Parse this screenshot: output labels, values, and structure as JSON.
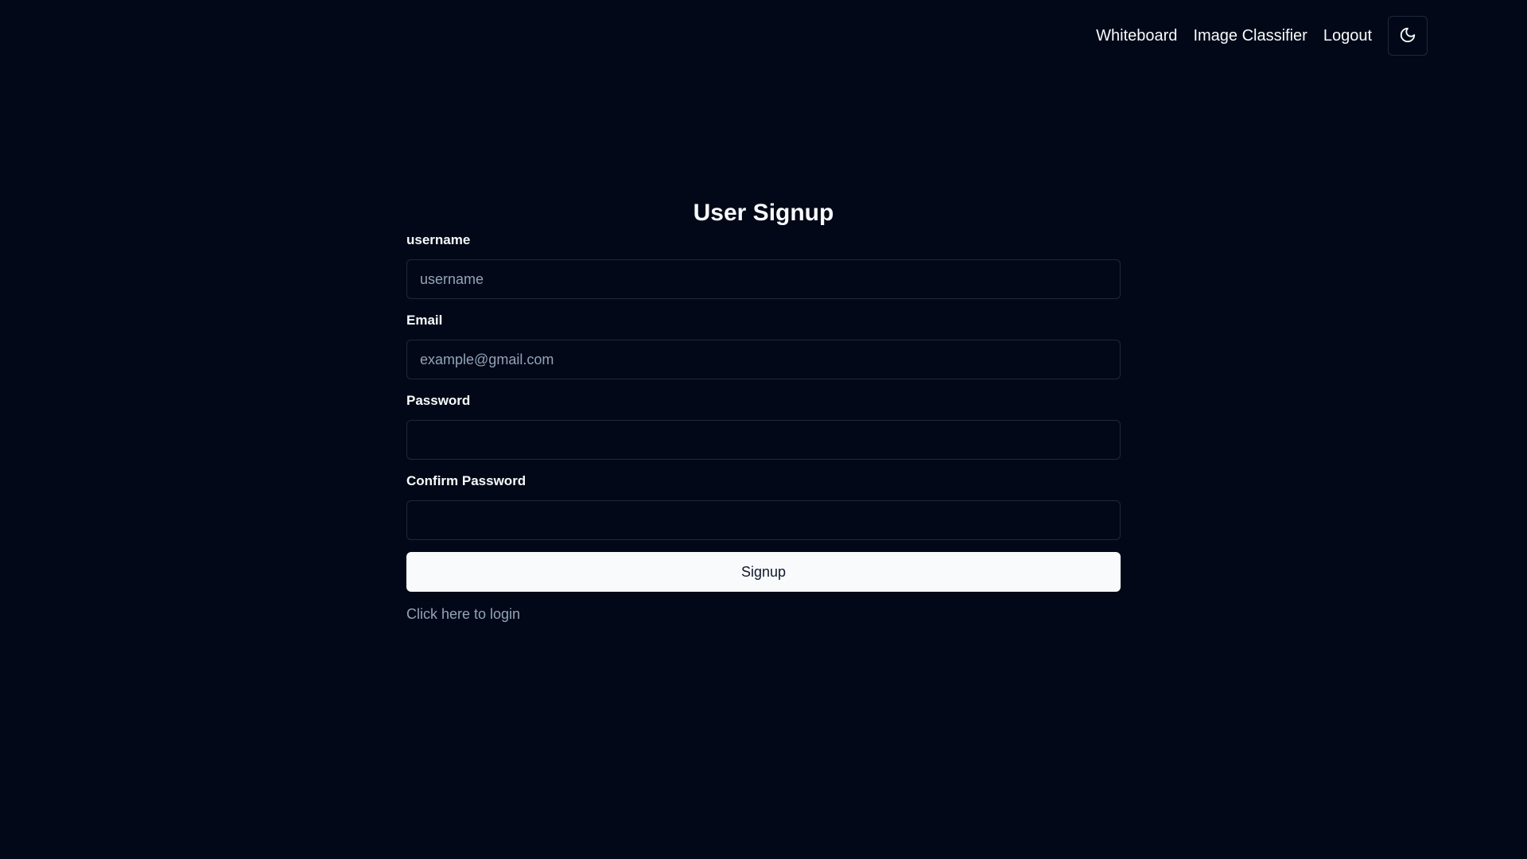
{
  "nav": {
    "links": [
      {
        "label": "Whiteboard"
      },
      {
        "label": "Image Classifier"
      },
      {
        "label": "Logout"
      }
    ],
    "theme_icon": "moon-icon"
  },
  "form": {
    "title": "User Signup",
    "username": {
      "label": "username",
      "placeholder": "username",
      "value": ""
    },
    "email": {
      "label": "Email",
      "placeholder": "example@gmail.com",
      "value": ""
    },
    "password": {
      "label": "Password",
      "placeholder": "",
      "value": ""
    },
    "confirm_password": {
      "label": "Confirm Password",
      "placeholder": "",
      "value": ""
    },
    "submit_label": "Signup",
    "login_link": "Click here to login"
  },
  "colors": {
    "background": "#020817",
    "border": "#1e293b",
    "text": "#f8fafc",
    "muted": "#94a3b8",
    "button_bg": "#f8fafc",
    "button_text": "#0f172a"
  }
}
